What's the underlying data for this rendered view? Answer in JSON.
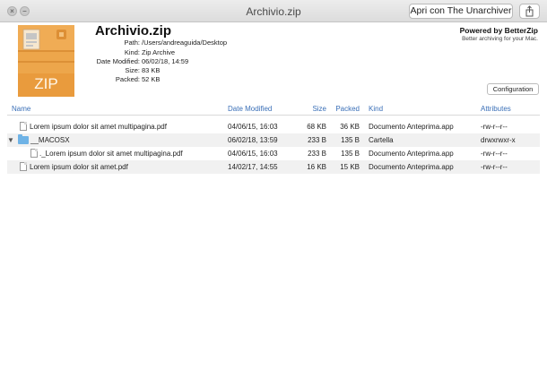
{
  "window": {
    "title": "Archivio.zip",
    "open_with_label": "Apri con The Unarchiver",
    "close_glyph": "×",
    "min_glyph": "–"
  },
  "archive": {
    "icon_label": "ZIP",
    "title": "Archivio.zip",
    "meta": [
      {
        "label": "Path:",
        "value": "/Users/andreaguida/Desktop"
      },
      {
        "label": "Kind:",
        "value": "Zip Archive"
      },
      {
        "label": "Date Modified:",
        "value": "06/02/18, 14:59"
      },
      {
        "label": "Size:",
        "value": "83 KB"
      },
      {
        "label": "Packed:",
        "value": "52 KB"
      }
    ]
  },
  "branding": {
    "powered": "Powered by BetterZip",
    "tagline": "Better archiving for your Mac."
  },
  "config_label": "Configuration",
  "table": {
    "headers": {
      "name": "Name",
      "date": "Date Modified",
      "size": "Size",
      "packed": "Packed",
      "kind": "Kind",
      "attributes": "Attributes"
    },
    "rows": [
      {
        "name": "Lorem ipsum dolor sit amet multipagina.pdf",
        "date": "04/06/15, 16:03",
        "size": "68 KB",
        "packed": "36 KB",
        "kind": "Documento Anteprima.app",
        "attributes": "-rw-r--r--"
      },
      {
        "name": "__MACOSX",
        "date": "06/02/18, 13:59",
        "size": "233 B",
        "packed": "135 B",
        "kind": "Cartella",
        "attributes": "drwxrwxr-x",
        "disclosure": "▼"
      },
      {
        "name": "._Lorem ipsum dolor sit amet multipagina.pdf",
        "date": "04/06/15, 16:03",
        "size": "233 B",
        "packed": "135 B",
        "kind": "Documento Anteprima.app",
        "attributes": "-rw-r--r--"
      },
      {
        "name": "Lorem ipsum dolor sit amet.pdf",
        "date": "14/02/17, 14:55",
        "size": "16 KB",
        "packed": "15 KB",
        "kind": "Documento Anteprima.app",
        "attributes": "-rw-r--r--"
      }
    ]
  }
}
